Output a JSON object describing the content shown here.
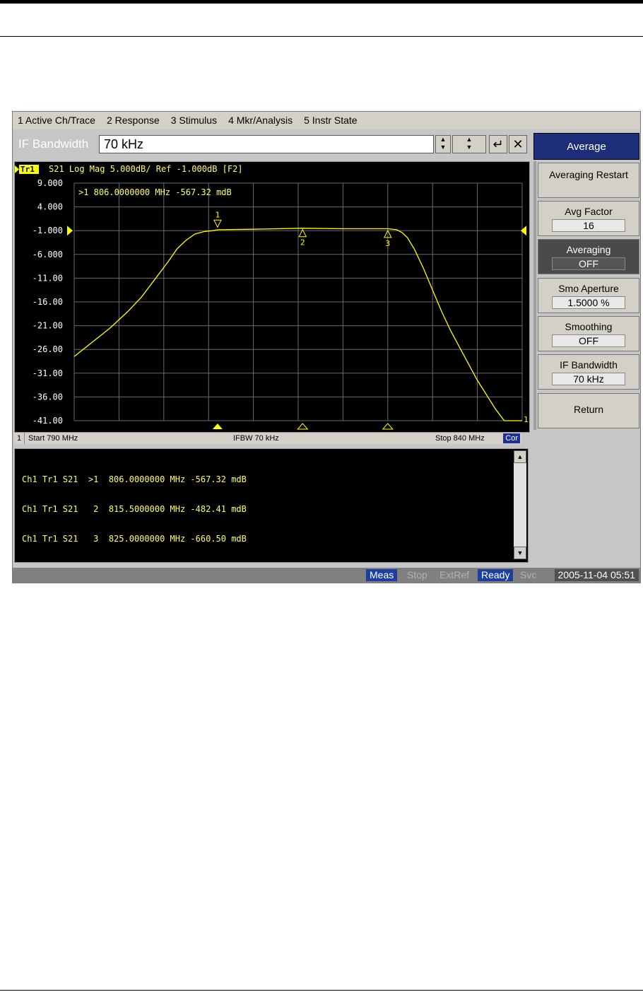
{
  "menu": [
    "1 Active Ch/Trace",
    "2 Response",
    "3 Stimulus",
    "4 Mkr/Analysis",
    "5 Instr State"
  ],
  "entry": {
    "label": "IF Bandwidth",
    "value": "70 kHz"
  },
  "trace_header": {
    "tag": "Tr1",
    "text": "S21 Log Mag 5.000dB/ Ref -1.000dB [F2]"
  },
  "active_marker_readout": ">1  806.0000000 MHz -567.32 mdB",
  "chart_data": {
    "type": "line",
    "x_unit": "MHz",
    "xlim": [
      790,
      840
    ],
    "ylim": [
      -41,
      9
    ],
    "y_ticks": [
      "9.000",
      "4.000",
      "-1.000",
      "-6.000",
      "-11.00",
      "-16.00",
      "-21.00",
      "-26.00",
      "-31.00",
      "-36.00",
      "-41.00"
    ],
    "reference_level": -1.0,
    "grid": true,
    "series": [
      {
        "color": "#ffff00",
        "x": [
          790,
          792,
          794,
          796,
          797.5,
          798.5,
          799.5,
          800.5,
          801.5,
          802.5,
          803.5,
          804.5,
          805.5,
          806,
          810,
          815.5,
          820,
          825,
          826,
          826.6,
          827.2,
          828,
          829,
          830,
          831,
          832,
          833,
          834,
          835,
          836,
          837,
          838,
          838.5,
          839,
          840
        ],
        "y": [
          -27.5,
          -24.5,
          -21.5,
          -18,
          -15,
          -12.5,
          -10,
          -7.5,
          -4.8,
          -3,
          -1.7,
          -1.2,
          -1.0,
          -0.8,
          -0.7,
          -0.5,
          -0.6,
          -0.6,
          -0.8,
          -1.4,
          -2.5,
          -5,
          -9,
          -13.5,
          -18,
          -22,
          -25.5,
          -29,
          -32.5,
          -35.5,
          -38.5,
          -41,
          -41,
          -41,
          -41
        ]
      }
    ],
    "markers": [
      {
        "id": "1",
        "x": 806,
        "y": -0.57,
        "active": true
      },
      {
        "id": "2",
        "x": 815.5,
        "y": -0.48,
        "active": false
      },
      {
        "id": "3",
        "x": 825,
        "y": -0.66,
        "active": false
      }
    ],
    "end_label": "1"
  },
  "status": {
    "start": "Start 790 MHz",
    "ifbw": "IFBW 70 kHz",
    "stop": "Stop 840 MHz",
    "cor": "Cor",
    "channel": "1"
  },
  "marker_table": [
    "Ch1 Tr1 S21  >1  806.0000000 MHz -567.32 mdB",
    "Ch1 Tr1 S21   2  815.5000000 MHz -482.41 mdB",
    "Ch1 Tr1 S21   3  825.0000000 MHz -660.50 mdB"
  ],
  "softkeys": {
    "header": "Average",
    "keys": [
      {
        "label": "Averaging Restart"
      },
      {
        "label": "Avg Factor",
        "value": "16"
      },
      {
        "label": "Averaging",
        "value": "OFF"
      },
      {
        "label": "Smo Aperture",
        "value": "1.5000  %"
      },
      {
        "label": "Smoothing",
        "value": "OFF"
      },
      {
        "label": "IF Bandwidth",
        "value": "70 kHz"
      },
      {
        "label": "Return"
      }
    ]
  },
  "bottom_status": {
    "meas": "Meas",
    "stop": "Stop",
    "extref": "ExtRef",
    "ready": "Ready",
    "svc": "Svc",
    "datetime": "2005-11-04 05:51"
  }
}
